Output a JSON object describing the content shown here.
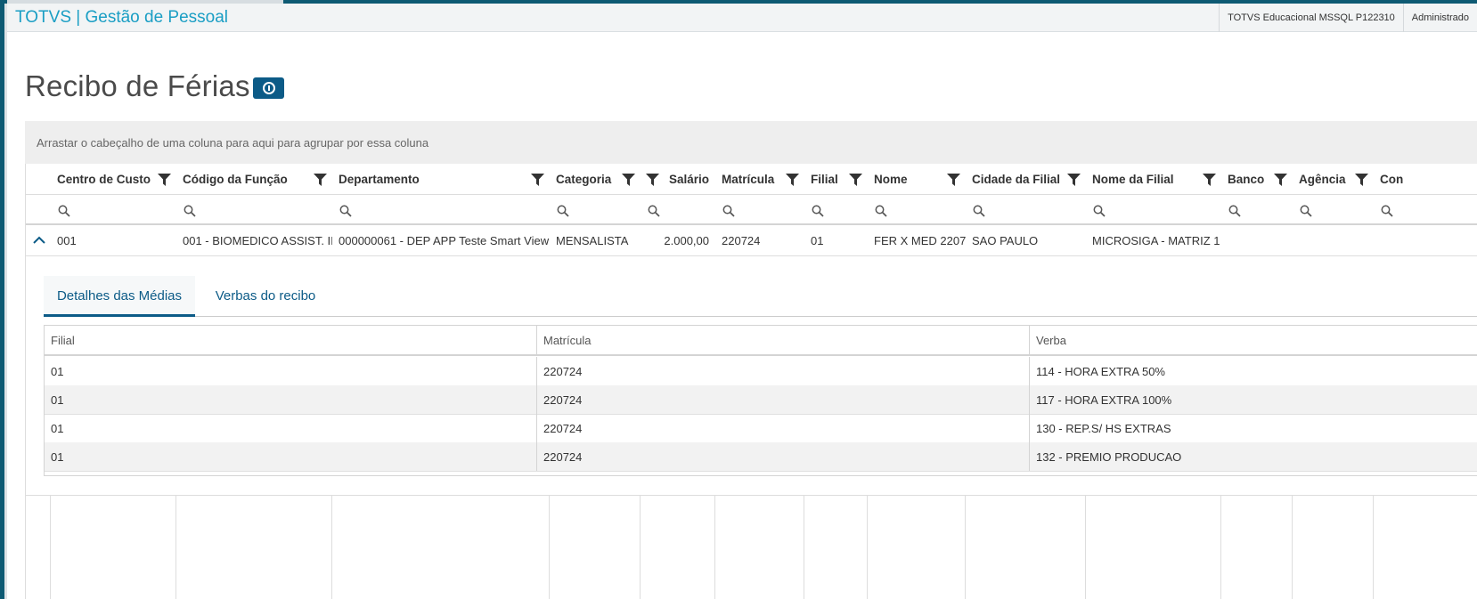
{
  "app": {
    "title": "TOTVS | Gestão de Pessoal",
    "environment": "TOTVS Educacional MSSQL P122310",
    "user": "Administrado"
  },
  "page": {
    "title": "Recibo de Férias"
  },
  "grid": {
    "group_hint": "Arrastar o cabeçalho de uma coluna para aqui para agrupar por essa coluna",
    "columns": [
      {
        "key": "centro_custo",
        "label": "Centro de Custo"
      },
      {
        "key": "codigo_funcao",
        "label": "Código da Função"
      },
      {
        "key": "departamento",
        "label": "Departamento"
      },
      {
        "key": "categoria",
        "label": "Categoria"
      },
      {
        "key": "salario",
        "label": "Salário"
      },
      {
        "key": "matricula",
        "label": "Matrícula"
      },
      {
        "key": "filial",
        "label": "Filial"
      },
      {
        "key": "nome",
        "label": "Nome"
      },
      {
        "key": "cidade_filial",
        "label": "Cidade da Filial"
      },
      {
        "key": "nome_filial",
        "label": "Nome da Filial"
      },
      {
        "key": "banco",
        "label": "Banco"
      },
      {
        "key": "agencia",
        "label": "Agência"
      },
      {
        "key": "conta",
        "label": "Con"
      }
    ],
    "rows": [
      {
        "centro_custo": "001",
        "codigo_funcao": "001 - BIOMEDICO ASSIST. II",
        "departamento": "000000061 - DEP APP Teste Smart View",
        "categoria": "MENSALISTA",
        "salario": "2.000,00",
        "matricula": "220724",
        "filial": "01",
        "nome": "FER X MED 2207",
        "cidade_filial": "SAO PAULO",
        "nome_filial": "MICROSIGA - MATRIZ 1",
        "banco": "",
        "agencia": "",
        "conta": ""
      }
    ]
  },
  "detail": {
    "tabs": [
      {
        "label": "Detalhes das Médias",
        "active": true
      },
      {
        "label": "Verbas do recibo",
        "active": false
      }
    ],
    "columns": [
      "Filial",
      "Matrícula",
      "Verba"
    ],
    "rows": [
      [
        "01",
        "220724",
        "114 - HORA EXTRA 50%"
      ],
      [
        "01",
        "220724",
        "117 - HORA EXTRA 100%"
      ],
      [
        "01",
        "220724",
        "130 - REP.S/ HS EXTRAS"
      ],
      [
        "01",
        "220724",
        "132 - PREMIO PRODUCAO"
      ]
    ]
  },
  "colors": {
    "brand": "#1a9ec4",
    "primary": "#0c5b87",
    "frame": "#0e5a73"
  },
  "icons": {
    "info": "info-icon",
    "filter": "funnel-icon",
    "search": "search-icon",
    "expand": "chevron-up-icon"
  }
}
